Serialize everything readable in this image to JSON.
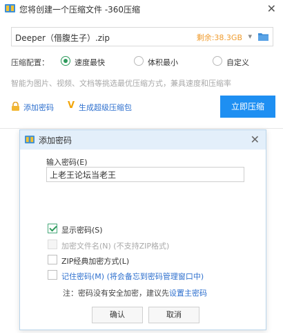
{
  "window": {
    "title": "您将创建一个压缩文件 -360压缩",
    "close_glyph": "✕",
    "icon": "360zip-app-icon"
  },
  "output": {
    "file_name": "Deeper（借腹生子）.zip",
    "free_space": "剩余:38.3GB",
    "dropdown_glyph": "▾",
    "folder_icon": "folder-icon"
  },
  "compression": {
    "label": "压缩配置：",
    "options": [
      {
        "label": "速度最快",
        "selected": true
      },
      {
        "label": "体积最小",
        "selected": false
      },
      {
        "label": "自定义",
        "selected": false
      }
    ],
    "hint": "智能为图片、视频、文档等挑选最优压缩方式，兼具速度和压缩率"
  },
  "actions": {
    "add_password": "添加密码",
    "make_sfx": "生成超级压缩包",
    "compress_now": "立即压缩"
  },
  "dialog": {
    "title": "添加密码",
    "close_glyph": "✕",
    "password_label": "输入密码(E)",
    "password_value": "上老王论坛当老王",
    "options": {
      "show_password": {
        "label": "显示密码(S)",
        "checked": true,
        "enabled": true
      },
      "encrypt_filenames": {
        "label": "加密文件名(N) (不支持ZIP格式)",
        "checked": false,
        "enabled": false
      },
      "zip_classic": {
        "label": "ZIP经典加密方式(L)",
        "checked": false,
        "enabled": true
      },
      "remember_password": {
        "label": "记住密码(M) (将会备忘到密码管理窗口中)",
        "checked": false,
        "enabled": true
      }
    },
    "note_prefix": "注：密码没有安全加密，建议先",
    "note_link": "设置主密码",
    "ok": "确认",
    "cancel": "取消"
  },
  "colors": {
    "accent_blue": "#1e8ff2",
    "link_blue": "#2d6fce",
    "radio_green": "#2d9a5b",
    "free_space_orange": "#f09b2c"
  }
}
